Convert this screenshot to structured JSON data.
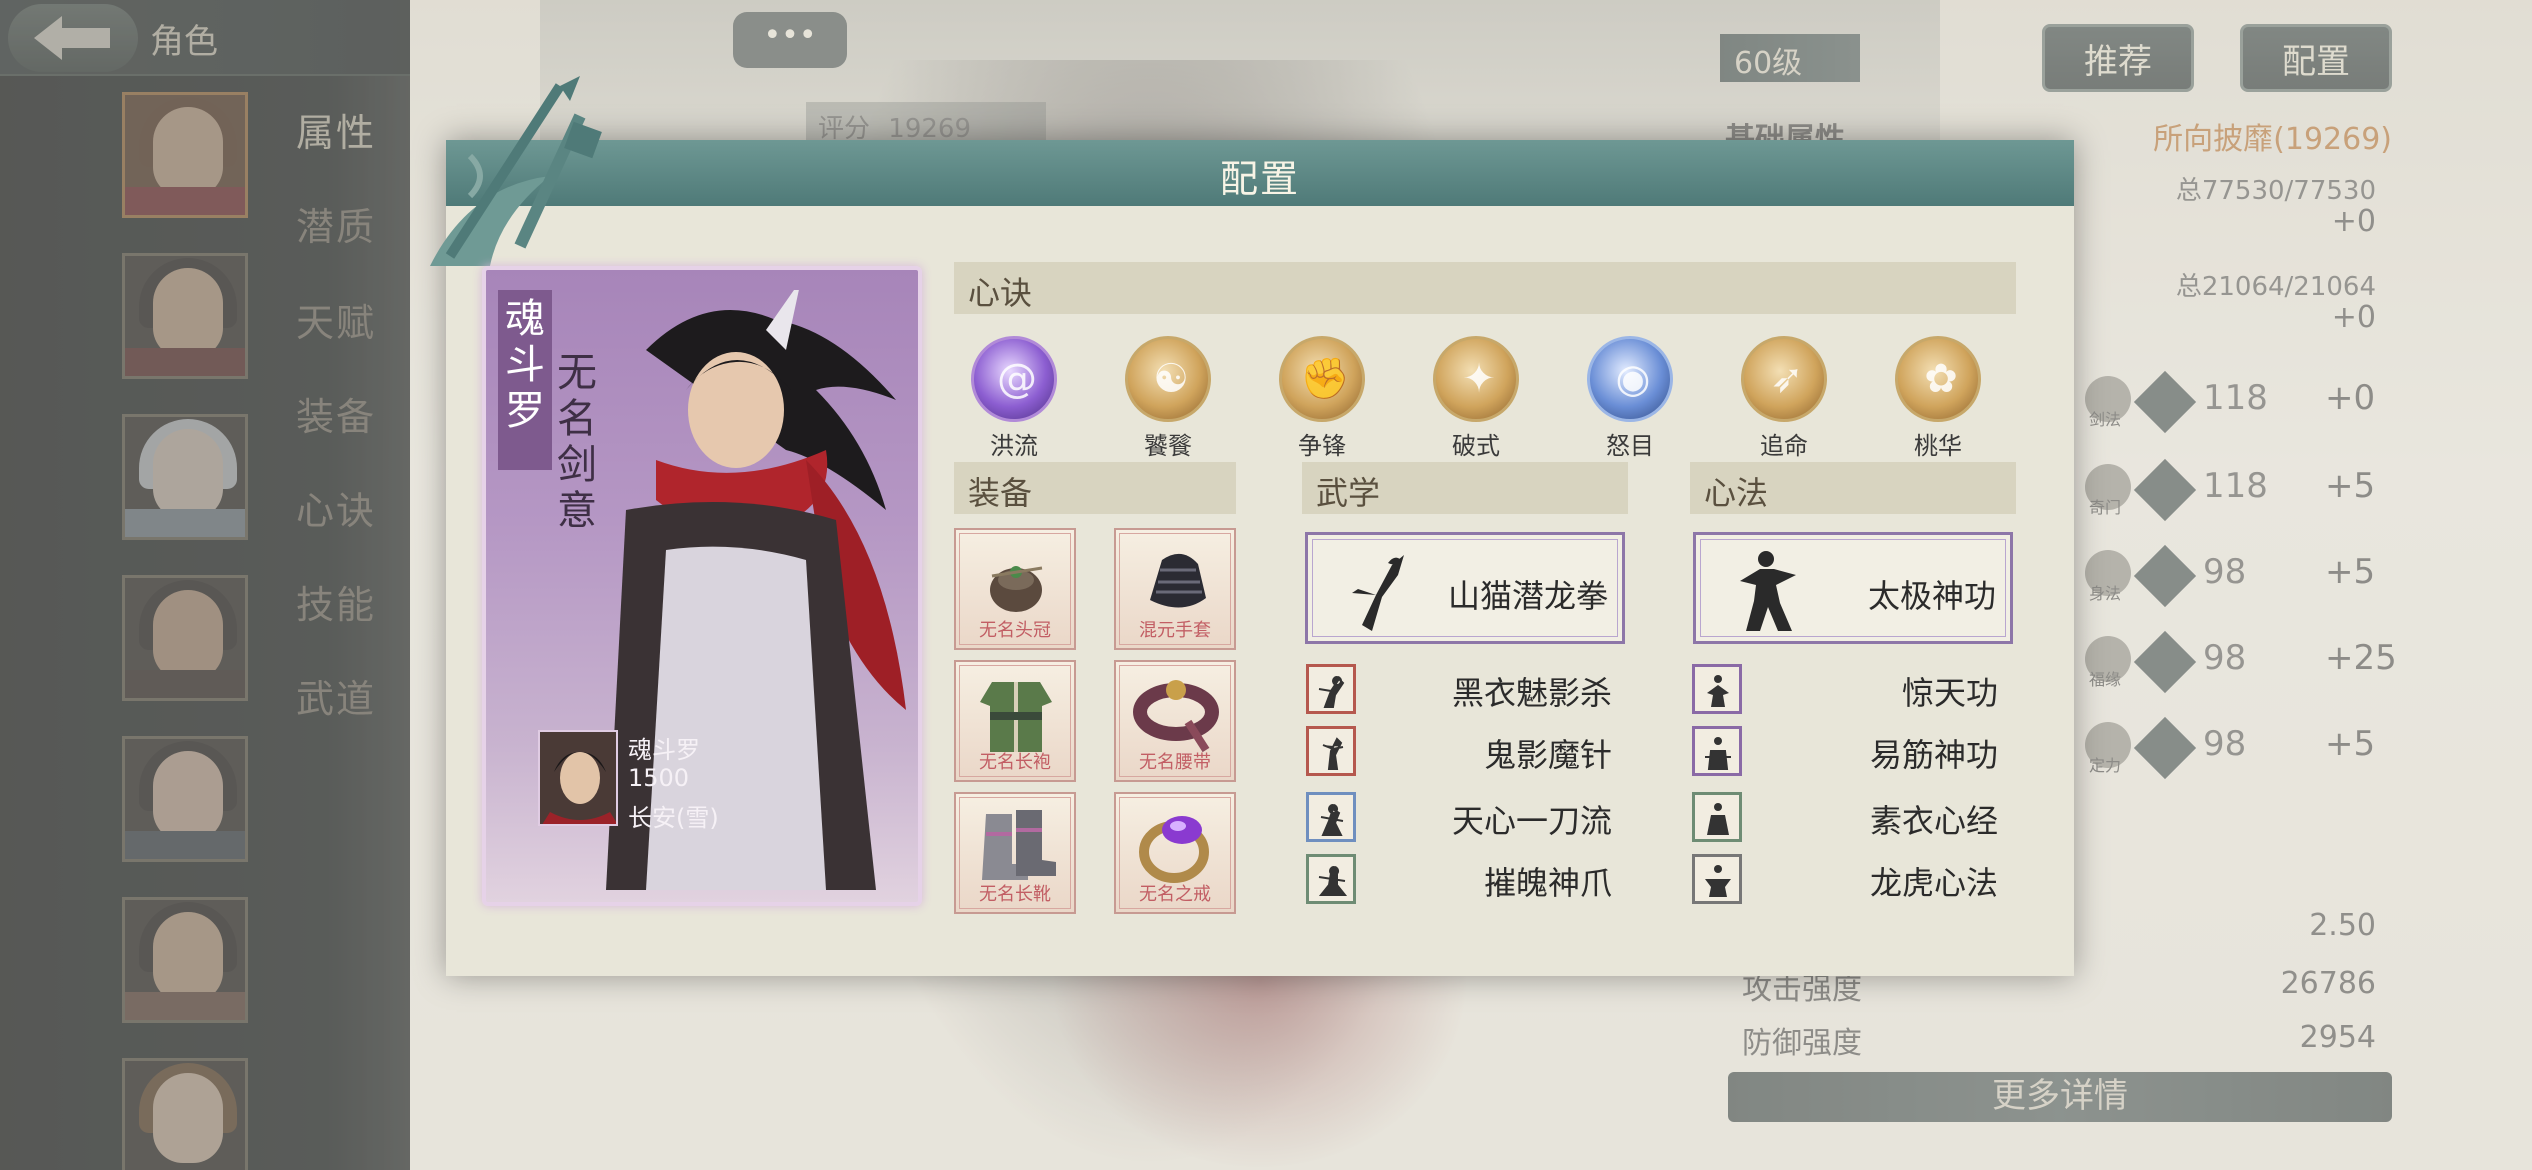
{
  "sidebar": {
    "title": "角色",
    "tabs": [
      "属性",
      "潜质",
      "天赋",
      "装备",
      "心诀",
      "技能",
      "武道"
    ]
  },
  "top": {
    "chat": "•••",
    "score_label": "评分",
    "score_value": "19269",
    "level": "60级",
    "recommend_btn": "推荐",
    "config_btn": "配置"
  },
  "stats": {
    "basic_title": "基础属性",
    "rank_text": "所向披靡(19269)",
    "total1": "总77530/77530",
    "plus1": "+0",
    "total2": "总21064/21064",
    "plus2": "+0",
    "skills": [
      {
        "name": "剑法",
        "level": "118",
        "plus": "+0"
      },
      {
        "name": "奇门",
        "level": "118",
        "plus": "+5"
      },
      {
        "name": "身法",
        "level": "98",
        "plus": "+5"
      },
      {
        "name": "福缘",
        "level": "98",
        "plus": "+25"
      },
      {
        "name": "定力",
        "level": "98",
        "plus": "+5"
      }
    ],
    "rate_value": "2.50",
    "attack_label": "攻击强度",
    "attack_value": "26786",
    "defense_label": "防御强度",
    "defense_value": "2954",
    "more_btn": "更多详情"
  },
  "modal": {
    "title": "配置",
    "card": {
      "name_vertical": "魂斗罗",
      "title_vertical": "无名剑意",
      "name": "魂斗罗",
      "power": "1500",
      "location": "长安(雪)"
    },
    "xinjue_title": "心诀",
    "xinjue": [
      {
        "label": "洪流",
        "icon": "swirl-icon",
        "style": "purple"
      },
      {
        "label": "饕餮",
        "icon": "beast-icon",
        "style": "gold"
      },
      {
        "label": "争锋",
        "icon": "fist-icon",
        "style": "gold"
      },
      {
        "label": "破式",
        "icon": "strike-icon",
        "style": "gold"
      },
      {
        "label": "怒目",
        "icon": "eye-icon",
        "style": "blue"
      },
      {
        "label": "追命",
        "icon": "dash-icon",
        "style": "gold"
      },
      {
        "label": "桃华",
        "icon": "figure-icon",
        "style": "gold"
      }
    ],
    "equip_title": "装备",
    "equipment": [
      {
        "label": "无名头冠",
        "icon": "hairpin-icon"
      },
      {
        "label": "混元手套",
        "icon": "gauntlet-icon"
      },
      {
        "label": "无名长袍",
        "icon": "robe-icon"
      },
      {
        "label": "无名腰带",
        "icon": "belt-icon"
      },
      {
        "label": "无名长靴",
        "icon": "boots-icon"
      },
      {
        "label": "无名之戒",
        "icon": "ring-icon"
      }
    ],
    "wuxue_title": "武学",
    "wuxue_main": "山猫潜龙拳",
    "wuxue": [
      {
        "label": "黑衣魅影杀",
        "color": "red"
      },
      {
        "label": "鬼影魔针",
        "color": "red"
      },
      {
        "label": "天心一刀流",
        "color": "blue"
      },
      {
        "label": "摧魄神爪",
        "color": "green"
      }
    ],
    "xinfa_title": "心法",
    "xinfa_main": "太极神功",
    "xinfa": [
      {
        "label": "惊天功",
        "color": "purple"
      },
      {
        "label": "易筋神功",
        "color": "purple"
      },
      {
        "label": "素衣心经",
        "color": "green"
      },
      {
        "label": "龙虎心法",
        "color": "gray"
      }
    ]
  }
}
